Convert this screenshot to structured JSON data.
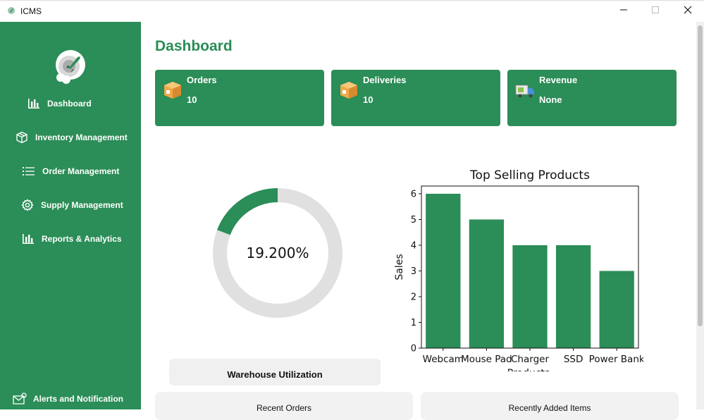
{
  "window": {
    "title": "ICMS",
    "minimize_icon": "minimize-icon",
    "maximize_icon": "maximize-icon",
    "close_icon": "close-icon"
  },
  "colors": {
    "brand_green": "#2b8d57",
    "donut_track": "#e0e0e0",
    "panel_bg": "#f2f2f2"
  },
  "sidebar": {
    "logo_icon": "rocket-logo-icon",
    "items": [
      {
        "label": "Dashboard",
        "icon": "bar-chart-icon"
      },
      {
        "label": "Inventory Management",
        "icon": "box-icon"
      },
      {
        "label": "Order Management",
        "icon": "list-icon"
      },
      {
        "label": "Supply Management",
        "icon": "gear-icon"
      },
      {
        "label": "Reports & Analytics",
        "icon": "bar-chart-icon"
      },
      {
        "label": "Alerts and Notification",
        "icon": "mail-alert-icon"
      }
    ]
  },
  "main": {
    "title": "Dashboard",
    "cards": [
      {
        "label": "Orders",
        "value": "10",
        "icon": "package-icon"
      },
      {
        "label": "Deliveries",
        "value": "10",
        "icon": "package-icon"
      },
      {
        "label": "Revenue",
        "value": "None",
        "icon": "delivery-truck-icon"
      }
    ],
    "warehouse": {
      "percent_text": "19.200%",
      "fraction": 0.192,
      "label": "Warehouse Utilization"
    },
    "panels": {
      "recent_orders": "Recent Orders",
      "recently_added": "Recently Added Items"
    }
  },
  "chart_data": {
    "type": "bar",
    "title": "Top Selling Products",
    "xlabel": "Products",
    "ylabel": "Sales",
    "categories": [
      "Webcam",
      "Mouse Pad",
      "Charger",
      "SSD",
      "Power Bank"
    ],
    "values": [
      6,
      5,
      4,
      4,
      3
    ],
    "yticks": [
      "0",
      "1",
      "2",
      "3",
      "4",
      "5",
      "6"
    ],
    "ylim": [
      0,
      6.3
    ],
    "bar_color": "#2b8d57",
    "grid": false
  }
}
